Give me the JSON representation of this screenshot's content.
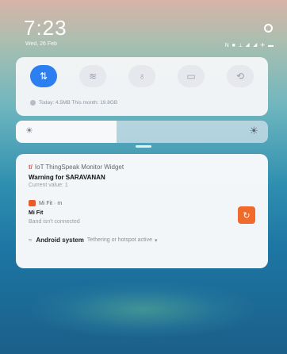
{
  "status_bar": {
    "time": "7:23",
    "date": "Wed, 26 Feb",
    "icons_text": "N ■ ⟂ ◢ ◢ ✈ ▬"
  },
  "quick_settings": {
    "tiles": [
      {
        "name": "data",
        "icon": "⇅",
        "active": true
      },
      {
        "name": "wifi",
        "icon": "≋",
        "active": false
      },
      {
        "name": "flashlight",
        "icon": "♁",
        "active": false
      },
      {
        "name": "screen",
        "icon": "▭",
        "active": false
      },
      {
        "name": "rotate",
        "icon": "⟲",
        "active": false
      }
    ],
    "data_usage": "Today: 4.5MB    This month: 19.8GB"
  },
  "brightness": {
    "level": 0.4
  },
  "notifications": {
    "iot": {
      "app_name": "IoT ThingSpeak Monitor Widget",
      "badge": "t/",
      "title": "Warning for SARAVANAN",
      "text": "Current value: 1"
    },
    "mifit": {
      "app_name": "Mi Fit · m",
      "title": "Mi Fit",
      "text": "Band isn't connected",
      "action_icon": "↻"
    },
    "android": {
      "icon": "≈",
      "name": "Android system",
      "text": "Tethering or hotspot active",
      "chevron": "▾"
    }
  },
  "colors": {
    "accent": "#2d7ff0",
    "mifit": "#ef6a2b"
  }
}
